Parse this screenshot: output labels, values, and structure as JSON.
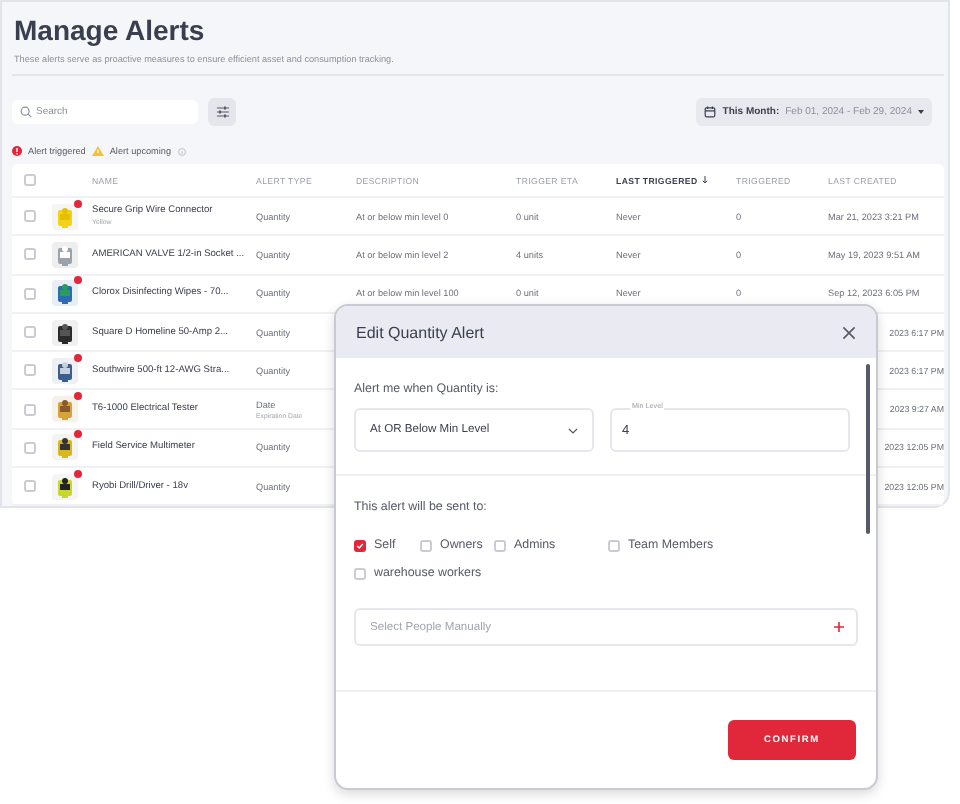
{
  "page": {
    "title": "Manage Alerts",
    "subtitle": "These alerts serve as proactive measures to ensure efficient asset and consumption tracking."
  },
  "toolbar": {
    "search": {
      "placeholder": "Search"
    },
    "date_filter": {
      "label": "This Month:",
      "range": "Feb 01, 2024 - Feb 29, 2024"
    }
  },
  "legend": [
    {
      "kind": "triggered",
      "label": "Alert triggered"
    },
    {
      "kind": "upcoming",
      "label": "Alert upcoming"
    }
  ],
  "table": {
    "all_selected": false,
    "columns": [
      {
        "label": "NAME",
        "sorted": false
      },
      {
        "label": "ALERT TYPE",
        "sorted": false
      },
      {
        "label": "DESCRIPTION",
        "sorted": false
      },
      {
        "label": "TRIGGER ETA",
        "sorted": false
      },
      {
        "label": "LAST TRIGGERED",
        "sorted": true
      },
      {
        "label": "TRIGGERED",
        "sorted": false
      },
      {
        "label": "LAST CREATED",
        "sorted": false
      }
    ],
    "rows": [
      {
        "selected": false,
        "triggered": true,
        "name": "Secure Grip Wire Connector",
        "variant": "Yellow",
        "alert_type": "Quantity",
        "description": "At or below min level 0",
        "trigger_eta": "0 unit",
        "last_triggered": "Never",
        "triggered_count": "0",
        "last_created": "Mar 21, 2023 3:21 PM"
      },
      {
        "selected": false,
        "triggered": false,
        "name": "AMERICAN VALVE 1/2-in Socket ...",
        "alert_type": "Quantity",
        "description": "At or below min level 2",
        "trigger_eta": "4 units",
        "last_triggered": "Never",
        "triggered_count": "0",
        "last_created": "May 19, 2023 9:51 AM"
      },
      {
        "selected": false,
        "triggered": true,
        "name": "Clorox Disinfecting Wipes - 70...",
        "alert_type": "Quantity",
        "description": "At or below min level 100",
        "trigger_eta": "0 unit",
        "last_triggered": "Never",
        "triggered_count": "0",
        "last_created": "Sep 12, 2023 6:05 PM"
      },
      {
        "selected": false,
        "triggered": false,
        "name": "Square D Homeline 50-Amp 2...",
        "alert_type": "Quantity",
        "last_created": "2023 6:17 PM"
      },
      {
        "selected": false,
        "triggered": true,
        "name": "Southwire 500-ft 12-AWG Stra...",
        "alert_type": "Quantity",
        "last_created": "2023 6:17 PM"
      },
      {
        "selected": false,
        "triggered": true,
        "name": "T6-1000 Electrical Tester",
        "alert_type": "Date",
        "alert_subtype": "Expiration Date",
        "last_created": "2023 9:27 AM"
      },
      {
        "selected": false,
        "triggered": true,
        "name": "Field Service Multimeter",
        "alert_type": "Quantity",
        "last_created": "2023 12:05 PM"
      },
      {
        "selected": false,
        "triggered": true,
        "name": "Ryobi Drill/Driver - 18v",
        "alert_type": "Quantity",
        "last_created": "2023 12:05 PM"
      }
    ]
  },
  "modal": {
    "title": "Edit Quantity Alert",
    "condition_label": "Alert me when Quantity is:",
    "condition_select": {
      "value": "At OR Below Min Level"
    },
    "min_level": {
      "label": "Min Level",
      "value": "4"
    },
    "recipients_label": "This alert will be sent to:",
    "recipients": [
      {
        "label": "Self",
        "checked": true
      },
      {
        "label": "Owners",
        "checked": false
      },
      {
        "label": "Admins",
        "checked": false
      },
      {
        "label": "Team Members",
        "checked": false
      },
      {
        "label": "warehouse workers",
        "checked": false
      }
    ],
    "people_field": {
      "placeholder": "Select People Manually"
    },
    "confirm": "CONFIRM"
  }
}
